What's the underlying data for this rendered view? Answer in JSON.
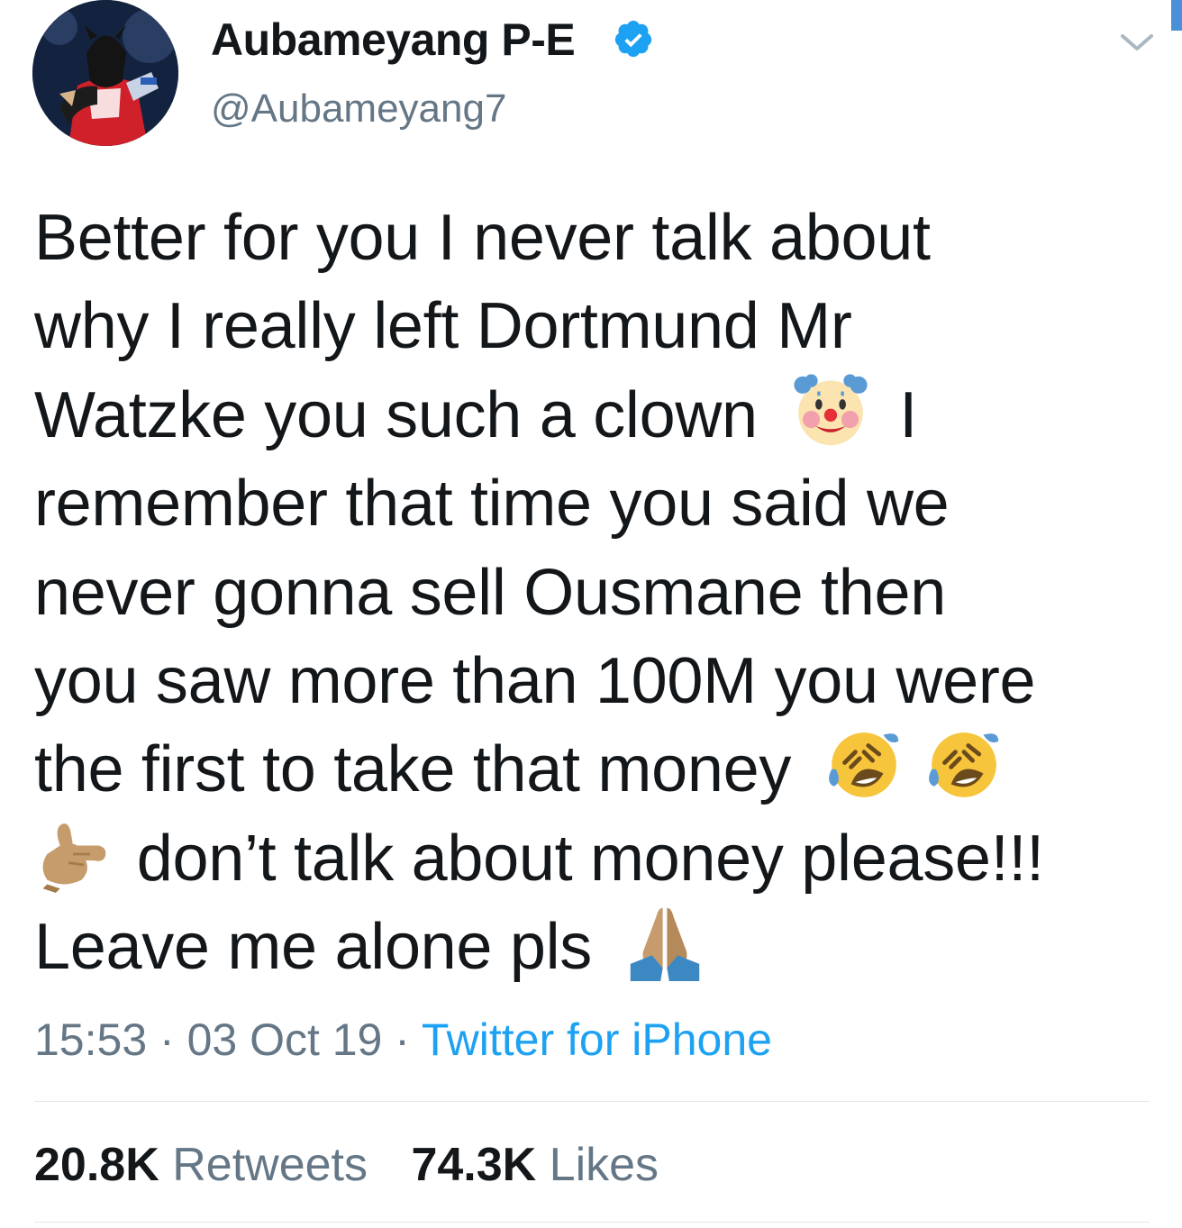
{
  "author": {
    "display_name": "Aubameyang P-E",
    "handle": "@Aubameyang7",
    "verified": true
  },
  "tweet": {
    "lines": [
      "Better for you I never talk about",
      "why I really left Dortmund Mr",
      "Watzke you such a clown",
      "I",
      "remember that time you said we",
      "never gonna sell Ousmane then",
      "you saw more than 100M you were",
      "the first to take that money",
      "don’t talk about money please!!!",
      "Leave me alone pls"
    ],
    "emojis": [
      "clown-face",
      "rolling-on-floor-laughing",
      "rolling-on-floor-laughing",
      "call-me-hand",
      "folded-hands"
    ]
  },
  "meta": {
    "time": "15:53",
    "date": "03 Oct 19",
    "separator": " · ",
    "source": "Twitter for iPhone"
  },
  "stats": {
    "retweets_count": "20.8K",
    "retweets_label": "Retweets",
    "likes_count": "74.3K",
    "likes_label": "Likes"
  },
  "colors": {
    "text": "#14171a",
    "secondary": "#657786",
    "link": "#1da1f2",
    "divider": "#e1e8ed"
  }
}
